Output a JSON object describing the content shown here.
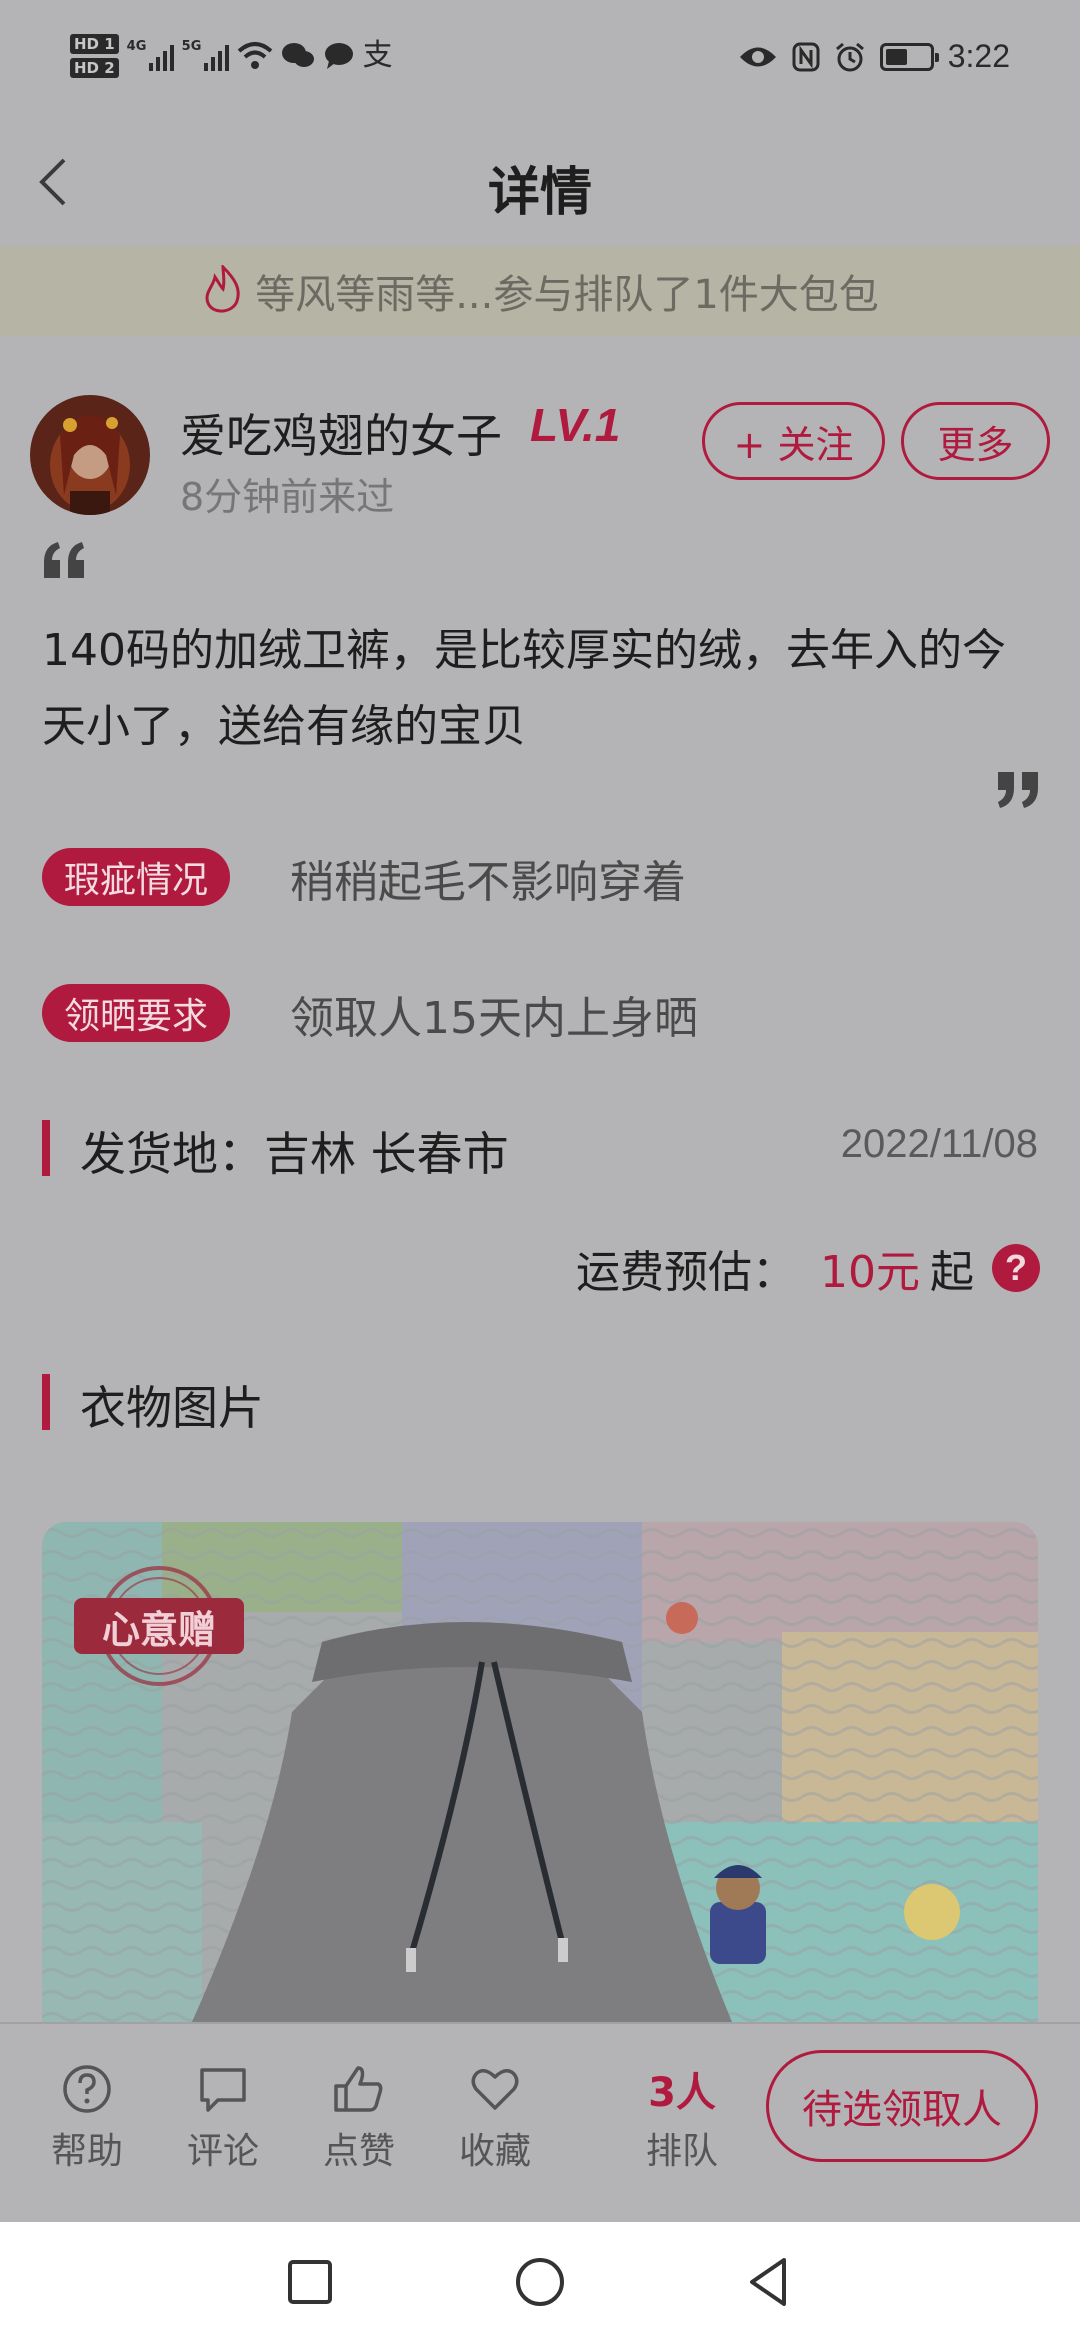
{
  "status_bar": {
    "sim1": "HD 1",
    "sim2": "HD 2",
    "net1": "4G",
    "net2": "5G",
    "alipay_glyph": "支",
    "time": "3:22",
    "battery_level": 0.5
  },
  "header": {
    "title": "详情"
  },
  "banner": {
    "text": "等风等雨等...参与排队了1件大包包"
  },
  "user": {
    "name": "爱吃鸡翅的女子",
    "level": "LV.1",
    "last_seen": "8分钟前来过",
    "follow_label": "+ 关注",
    "more_label": "更多"
  },
  "post": {
    "description": "140码的加绒卫裤，是比较厚实的绒，去年入的今天小了，送给有缘的宝贝",
    "defects_tag": "瑕疵情况",
    "defects_text": "稍稍起毛不影响穿着",
    "requirement_tag": "领晒要求",
    "requirement_text": "领取人15天内上身晒"
  },
  "shipping": {
    "location_label": "发货地：吉林 长春市",
    "date": "2022/11/08",
    "cost_label": "运费预估：",
    "cost_value": "10元",
    "cost_suffix": "起",
    "help_icon": "?"
  },
  "photos": {
    "section_title": "衣物图片",
    "stamp_label": "心意赠"
  },
  "bottom_bar": {
    "help": "帮助",
    "comment": "评论",
    "like": "点赞",
    "favorite": "收藏",
    "queue_count": "3人",
    "queue_label": "排队",
    "candidate_button": "待选领取人"
  },
  "colors": {
    "accent": "#b01a3e",
    "background": "#b4b4b6",
    "banner_bg": "#b6b4a4"
  }
}
